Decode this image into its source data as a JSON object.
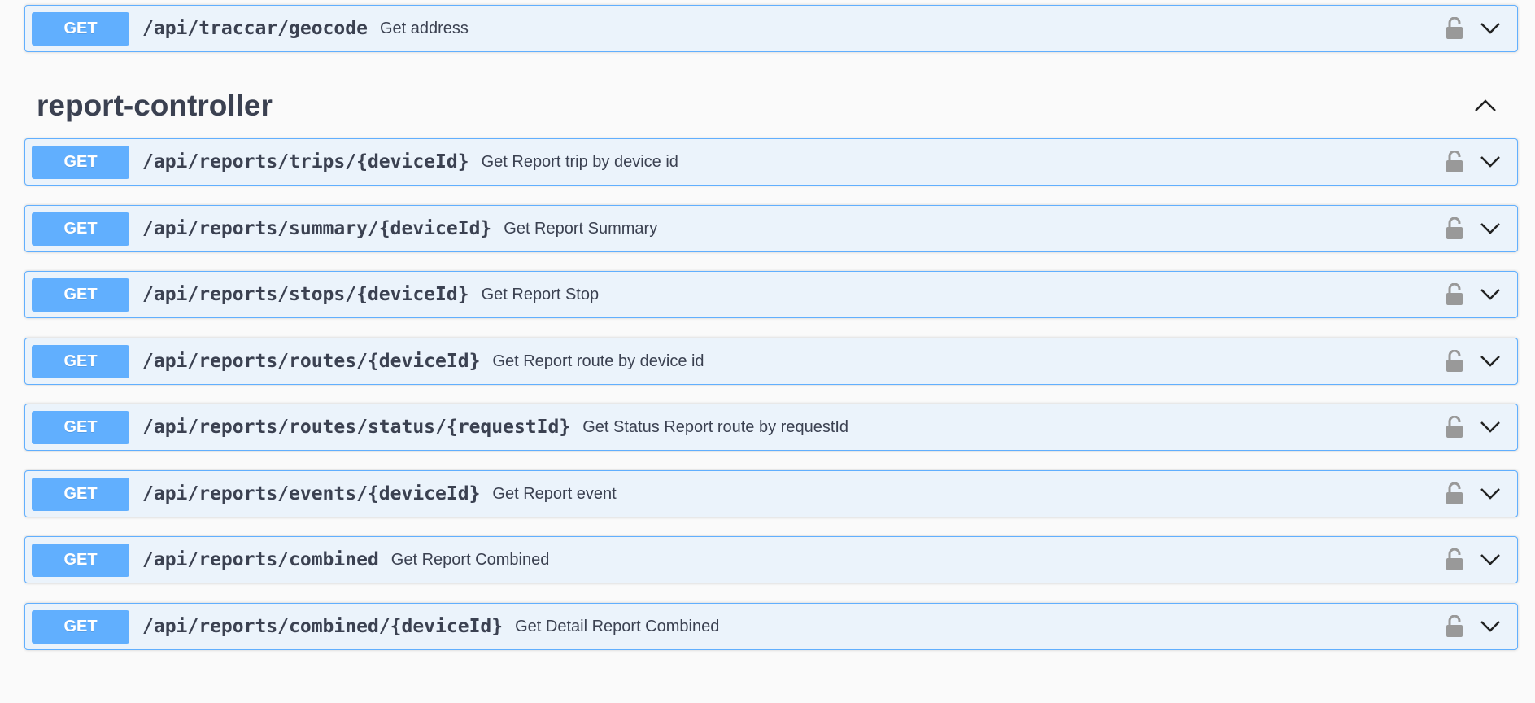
{
  "top_endpoint": {
    "method": "GET",
    "path": "/api/traccar/geocode",
    "summary": "Get address"
  },
  "section": {
    "title": "report-controller",
    "endpoints": [
      {
        "method": "GET",
        "path": "/api/reports/trips/{deviceId}",
        "summary": "Get Report trip by device id"
      },
      {
        "method": "GET",
        "path": "/api/reports/summary/{deviceId}",
        "summary": "Get Report Summary"
      },
      {
        "method": "GET",
        "path": "/api/reports/stops/{deviceId}",
        "summary": "Get Report Stop"
      },
      {
        "method": "GET",
        "path": "/api/reports/routes/{deviceId}",
        "summary": "Get Report route by device id"
      },
      {
        "method": "GET",
        "path": "/api/reports/routes/status/{requestId}",
        "summary": "Get Status Report route by requestId"
      },
      {
        "method": "GET",
        "path": "/api/reports/events/{deviceId}",
        "summary": "Get Report event"
      },
      {
        "method": "GET",
        "path": "/api/reports/combined",
        "summary": "Get Report Combined"
      },
      {
        "method": "GET",
        "path": "/api/reports/combined/{deviceId}",
        "summary": "Get Detail Report Combined"
      }
    ]
  },
  "colors": {
    "get_method": "#61affe",
    "get_background": "#ebf3fb",
    "text": "#3b4151",
    "lock_icon": "#999999"
  },
  "icons": {
    "lock": "unlocked-padlock-icon",
    "expand": "chevron-down-icon",
    "collapse": "chevron-up-icon"
  }
}
